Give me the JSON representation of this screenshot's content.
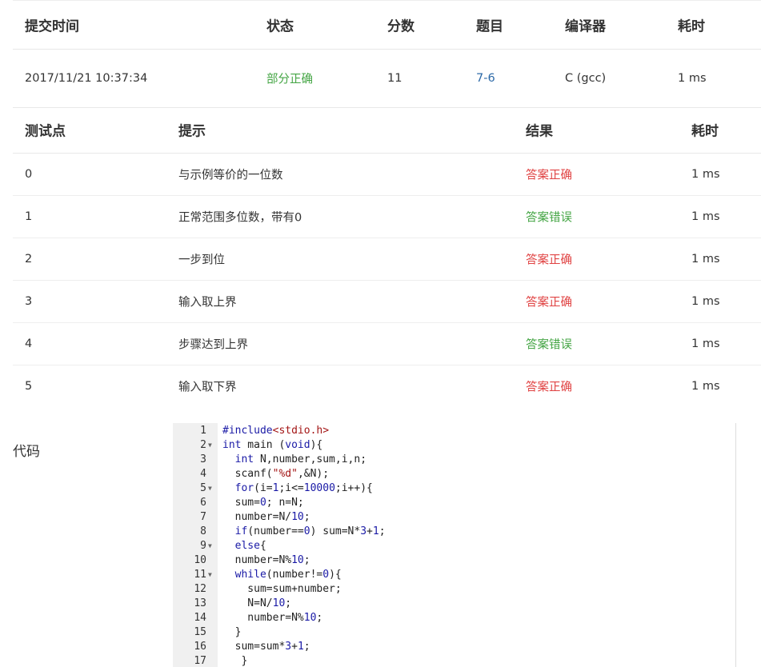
{
  "submission": {
    "headers": [
      "提交时间",
      "状态",
      "分数",
      "题目",
      "编译器",
      "耗时"
    ],
    "time": "2017/11/21 10:37:34",
    "status": "部分正确",
    "score": "11",
    "problem": "7-6",
    "compiler": "C (gcc)",
    "elapsed": "1 ms"
  },
  "tests": {
    "headers": [
      "测试点",
      "提示",
      "结果",
      "耗时"
    ],
    "rows": [
      {
        "id": "0",
        "hint": "与示例等价的一位数",
        "result": "答案正确",
        "time": "1 ms"
      },
      {
        "id": "1",
        "hint": "正常范围多位数，带有0",
        "result": "答案错误",
        "time": "1 ms"
      },
      {
        "id": "2",
        "hint": "一步到位",
        "result": "答案正确",
        "time": "1 ms"
      },
      {
        "id": "3",
        "hint": "输入取上界",
        "result": "答案正确",
        "time": "1 ms"
      },
      {
        "id": "4",
        "hint": "步骤达到上界",
        "result": "答案错误",
        "time": "1 ms"
      },
      {
        "id": "5",
        "hint": "输入取下界",
        "result": "答案正确",
        "time": "1 ms"
      }
    ]
  },
  "code": {
    "label": "代码",
    "lines": [
      "#include<stdio.h>",
      "int main (void){",
      "  int N,number,sum,i,n;",
      "  scanf(\"%d\",&N);",
      "  for(i=1;i<=10000;i++){",
      "  sum=0; n=N;",
      "  number=N/10;",
      "  if(number==0) sum=N*3+1;",
      "  else{",
      "  number=N%10;",
      "  while(number!=0){",
      "    sum=sum+number;",
      "    N=N/10;",
      "    number=N%10;",
      "  }",
      "  sum=sum*3+1;",
      "   }"
    ]
  },
  "colors": {
    "correct": "#e04343",
    "wrong": "#44a544",
    "partial": "#44a544",
    "link": "#2d6aa8"
  },
  "icons": {
    "fold": "fold-arrow-icon"
  }
}
